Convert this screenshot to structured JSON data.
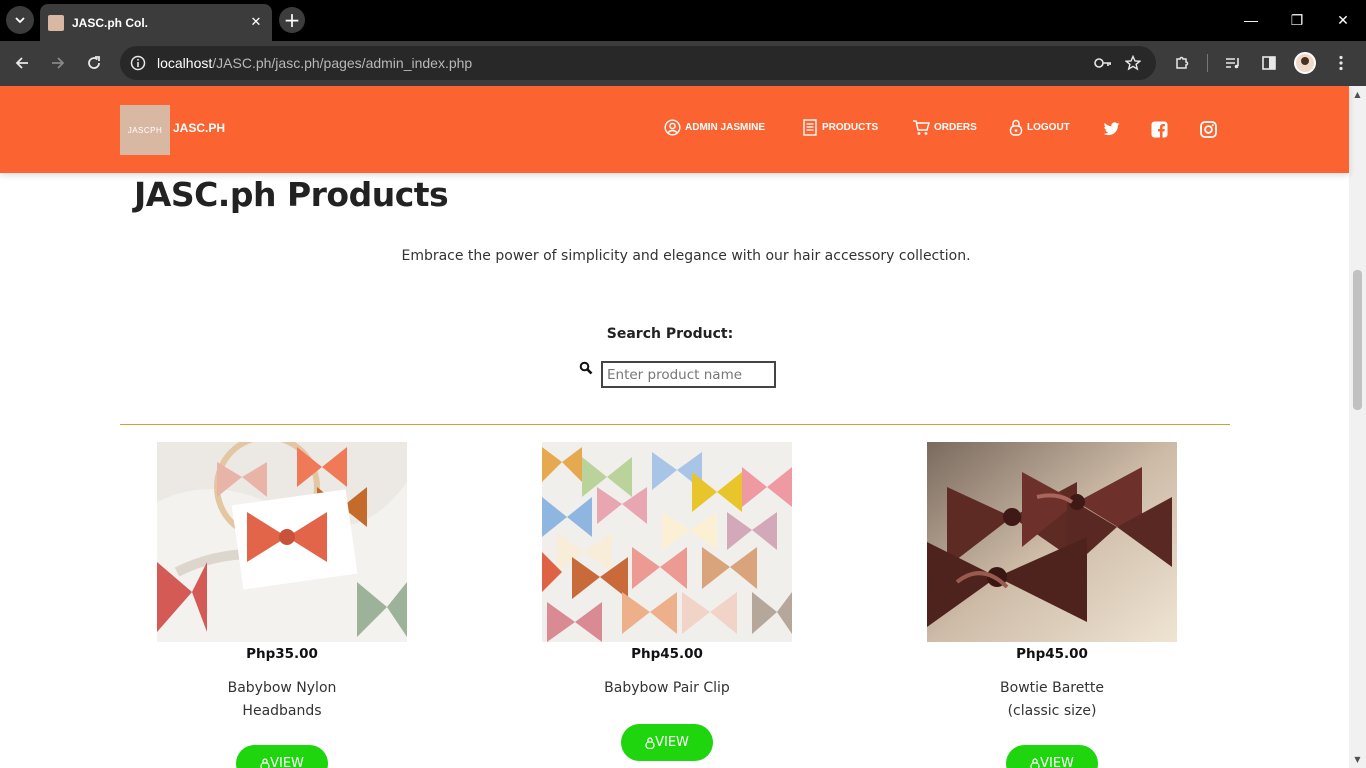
{
  "browser": {
    "tab_title": "JASC.ph Col.",
    "url_host": "localhost",
    "url_path": "/JASC.ph/jasc.ph/pages/admin_index.php",
    "minimize": "—",
    "restore": "❐",
    "close": "✕"
  },
  "header": {
    "logo_text": "JASCPH",
    "brand": "JASC.PH",
    "nav": [
      {
        "label": "ADMIN JASMINE",
        "icon": "user-circle-icon"
      },
      {
        "label": "PRODUCTS",
        "icon": "document-icon"
      },
      {
        "label": "ORDERS",
        "icon": "cart-icon"
      },
      {
        "label": "LOGOUT",
        "icon": "lock-icon"
      }
    ],
    "social": [
      "twitter-icon",
      "facebook-icon",
      "instagram-icon"
    ],
    "accent": "#fb6431"
  },
  "main": {
    "title": "JASC.ph Products",
    "tagline": "Embrace the power of simplicity and elegance with our hair accessory collection.",
    "search_label": "Search Product:",
    "search_placeholder": "Enter product name"
  },
  "products": [
    {
      "price": "Php35.00",
      "name_line1": "Babybow Nylon",
      "name_line2": "Headbands",
      "button": "VIEW"
    },
    {
      "price": "Php45.00",
      "name_line1": "Babybow Pair Clip",
      "name_line2": "",
      "button": "VIEW"
    },
    {
      "price": "Php45.00",
      "name_line1": "Bowtie Barette",
      "name_line2": "(classic size)",
      "button": "VIEW"
    }
  ]
}
